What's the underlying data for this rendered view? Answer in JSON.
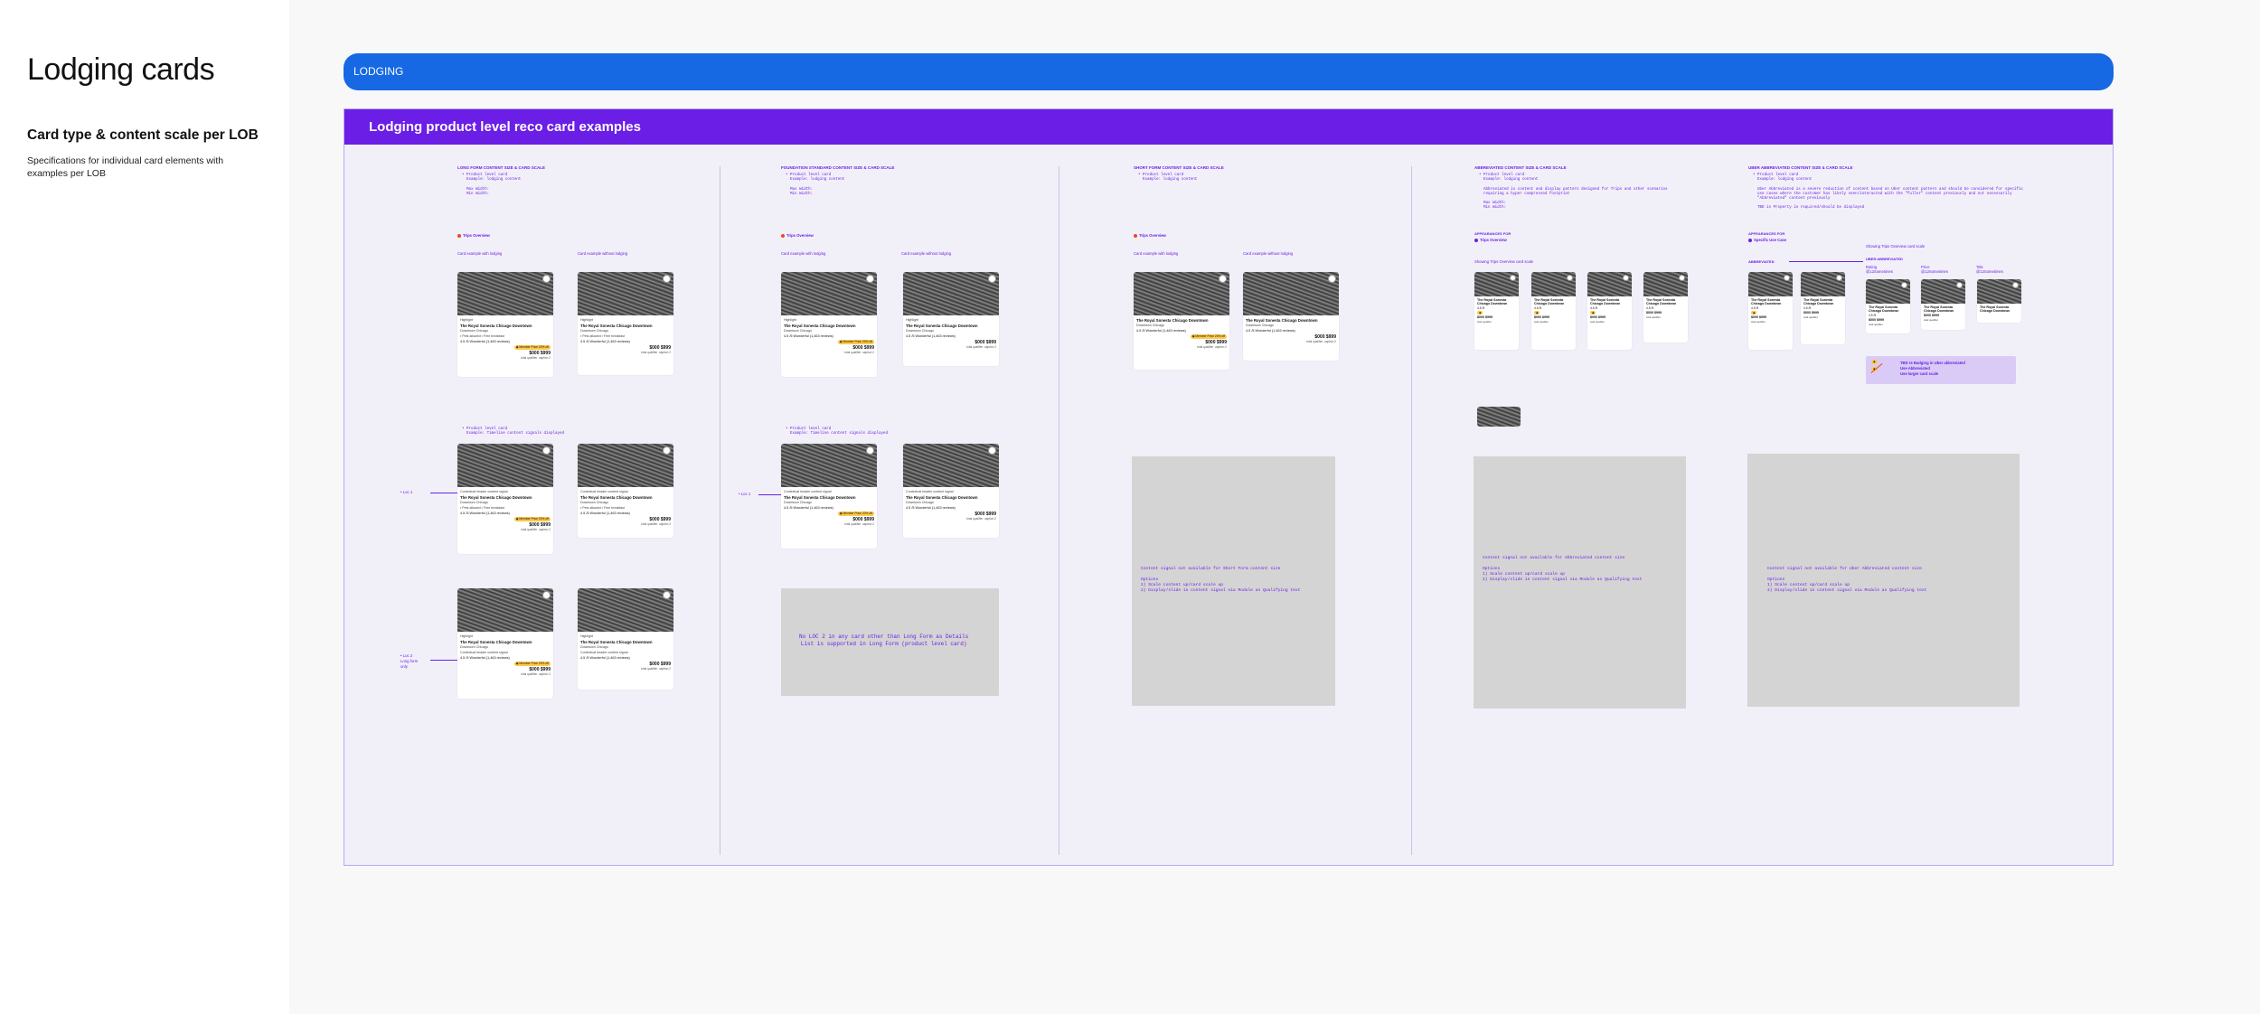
{
  "page": {
    "title": "Lodging cards",
    "subtitle": "Card type & content scale per LOB",
    "description": "Specifications for individual card elements with examples per LOB"
  },
  "lodging_bar": {
    "label": "LODGING"
  },
  "board": {
    "title": "Lodging product level reco card examples"
  },
  "sections": [
    {
      "title": "LONG FORM CONTENT SIZE & CARD SCALE",
      "spec_lines": [
        "• Product level card",
        "  Example: lodging content",
        "",
        "  Max Width:",
        "  Min Width:"
      ],
      "appears_for": "Trips Overview",
      "label_with": "Card example with lodging",
      "label_without": "Card example without lodging",
      "spec2": [
        "• Product level card",
        "  Example: Timeline content signals displayed"
      ],
      "loc1": "• Loc 1",
      "loc2": [
        "• Loc 2",
        "Long form",
        "only"
      ]
    },
    {
      "title": "FOUNDATION STANDARD CONTENT SIZE & CARD SCALE",
      "spec_lines": [
        "• Product level card",
        "  Example: lodging content",
        "",
        "  Max Width:",
        "  Min Width:"
      ],
      "appears_for": "Trips Overview",
      "label_with": "Card example with lodging",
      "label_without": "Card example without lodging",
      "spec2": [
        "• Product level card",
        "  Example: Timeline content signals displayed"
      ],
      "loc1": "• Loc 1",
      "placeholder": "No LOC 2 in any card other than Long Form as Details\nList is supported in Long Form (product level card)"
    },
    {
      "title": "SHORT FORM CONTENT SIZE & CARD SCALE",
      "spec_lines": [
        "• Product level card",
        "  Example: lodging content"
      ],
      "appears_for": "Trips Overview",
      "label_with": "Card example with lodging",
      "label_without": "Card example without lodging",
      "placeholder": "Content signal not available for Short Form content size\n\nOptions\n1) Scale content up/card scale up\n2) Display/slide in content signal via Module as Qualifying text"
    },
    {
      "title": "ABBREVIATED CONTENT SIZE & CARD SCALE",
      "spec_lines": [
        "• Product level card",
        "  Example: lodging content",
        "",
        "  Abbreviated is content and display pattern designed for Trips and other scenarios",
        "  requiring a hyper compressed footprint",
        "",
        "  Max Width:",
        "  Min Width:"
      ],
      "appears_for_label": "APPEARANCES FOR",
      "appears_for": "Trips Overview",
      "label_showing": "Showing Trips Overview card scale",
      "placeholder": "Content signal not available for Abbreviated content size\n\nOptions\n1) Scale content up/card scale up\n2) Display/slide in content signal via Module as Qualifying text"
    },
    {
      "title": "UBER ABBREVIATED CONTENT SIZE & CARD SCALE",
      "spec_lines": [
        "• Product level card",
        "  Example: lodging content",
        "",
        "  Uber Abbreviated is a severe reduction of content based on Uber content pattern and should be considered for specific",
        "  use cases where the customer has likely seen/interacted with the \"fuller\" content previously and not necessarily",
        "  \"Abbreviated\" content previously",
        "",
        "  TBD is Property in required/should be displayed"
      ],
      "appears_for_label": "APPEARANCES FOR",
      "appears_for": "Specific Use Case",
      "label_showing": "Showing Trips Overview card scale",
      "label_abbrev": "ABBREVIATED",
      "label_uber": "UBER ABBREVIATED",
      "uber_cols": [
        "Rating @12Sometimes",
        "Price @12Sometimes",
        "Title @12Sometimes"
      ],
      "legend": [
        "TBD re Badging in Uber abbreviated",
        "Use Abbreviated",
        "Use larger card scale"
      ],
      "placeholder": "Content signal not available for Uber Abbreviated content size\n\nOptions\n1) Scale content up/card scale up\n2) Display/slide in content signal via Module as Qualifying text"
    }
  ],
  "card": {
    "sponsor": "Highlight",
    "title": "The Royal Sonesta Chicago Downtown",
    "title_short": "The Royal Sonesta Chicago Downtown",
    "location": "Downtown Chicago",
    "amenity1": "Pets allowed",
    "amenity2": "Free breakfast",
    "rating": "4.5 /5",
    "rating_text": "Wonderful (1,463 reviews)",
    "signal": "Contextual header content signal",
    "badge": "Member Price 20% off",
    "old_price": "$000",
    "price": "$999",
    "fine1": "total qualifier",
    "fine2": "caption 2"
  }
}
